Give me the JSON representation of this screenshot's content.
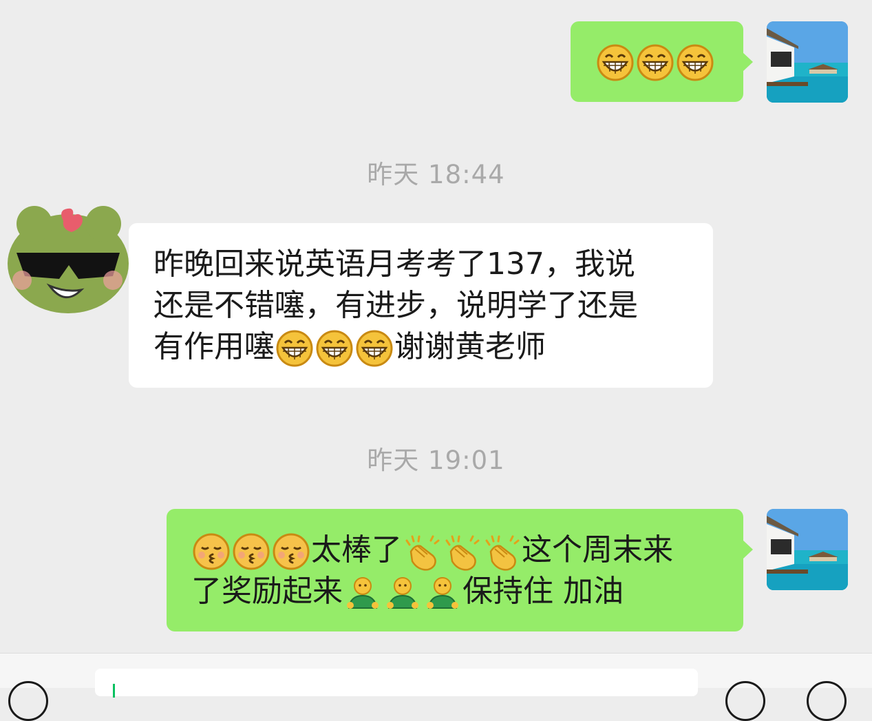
{
  "chat": {
    "msg1": {
      "side": "me",
      "emojis": [
        "grin",
        "grin",
        "grin"
      ]
    },
    "ts1": "昨天 18:44",
    "msg2": {
      "side": "them",
      "line1": "昨晚回来说英语月考考了137，我说",
      "line2": "还是不错噻，有进步，说明学了还是",
      "line3_pre": "有作用噻",
      "line3_post": "谢谢黄老师",
      "emojis": [
        "grin",
        "grin",
        "grin"
      ]
    },
    "ts2": "昨天 19:01",
    "msg3": {
      "side": "me",
      "line1_mid": "太棒了",
      "line1_end": "这个周末来",
      "line2_start": "了奖励起来",
      "line2_end": "保持住 加油",
      "emojis_kiss": [
        "kissing-closed-eyes",
        "kissing-closed-eyes",
        "kissing-closed-eyes"
      ],
      "emojis_clap": [
        "clapping-hands",
        "clapping-hands",
        "clapping-hands"
      ],
      "emojis_person": [
        "person",
        "person",
        "person"
      ]
    }
  },
  "colors": {
    "me_bubble": "#95ec69",
    "them_bubble": "#ffffff",
    "background": "#ededed",
    "timestamp": "#a9a9a9"
  },
  "bottom_bar": {
    "icons": [
      "voice-icon",
      "emoji-icon",
      "plus-icon"
    ]
  }
}
